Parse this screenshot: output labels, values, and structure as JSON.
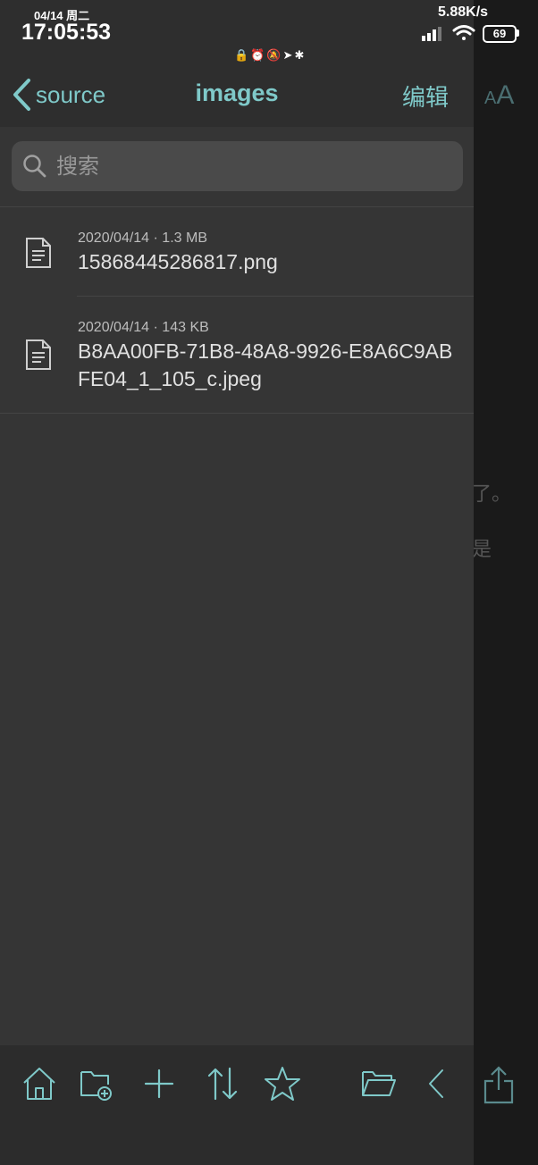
{
  "status_bar": {
    "date": "04/14 周二",
    "time": "17:05:53",
    "net_speed": "5.88K/s",
    "battery": "69",
    "indicator_icons": "🔒⏰🔕➤✱"
  },
  "nav": {
    "back_label": "source",
    "title": "images",
    "edit_label": "编辑"
  },
  "search": {
    "placeholder": "搜索"
  },
  "files": [
    {
      "meta": "2020/04/14  ·  1.3 MB",
      "name": "15868445286817.png"
    },
    {
      "meta": "2020/04/14  ·  143 KB",
      "name": "B8AA00FB-71B8-48A8-9926-E8A6C9ABFE04_1_105_c.jpeg"
    }
  ],
  "background_editor": {
    "font_size_small": "A",
    "font_size_big": "A",
    "text1": "了。",
    "text2": "是"
  },
  "colors": {
    "accent": "#7fc9c9",
    "drawer_bg": "#353535",
    "editor_bg": "#1a1a1a"
  },
  "toolbar_icons": [
    "home-icon",
    "new-folder-icon",
    "add-icon",
    "sort-icon",
    "favorite-icon",
    "folder-icon",
    "back-icon",
    "share-icon"
  ]
}
